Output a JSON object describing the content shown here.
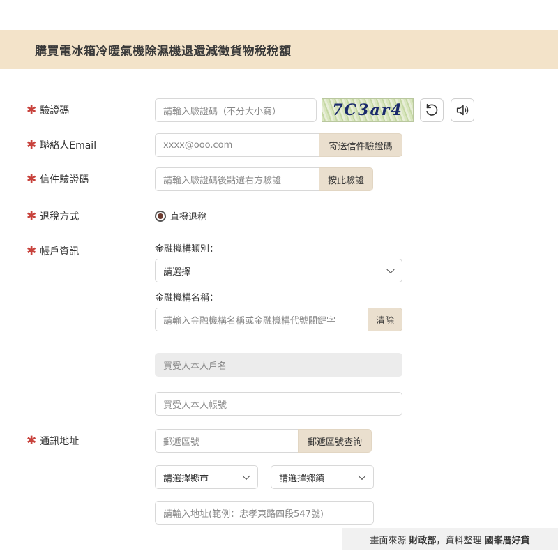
{
  "header": {
    "title": "購買電冰箱冷暖氣機除濕機退還減徵貨物稅稅額"
  },
  "form": {
    "captcha": {
      "label": "驗證碼",
      "placeholder": "請輸入驗證碼（不分大小寫）",
      "image_text": "7C3ar4",
      "refresh_icon": "refresh-icon",
      "audio_icon": "speaker-icon"
    },
    "email": {
      "label": "聯絡人Email",
      "placeholder": "xxxx@ooo.com",
      "button": "寄送信件驗證碼"
    },
    "email_code": {
      "label": "信件驗證碼",
      "placeholder": "請輸入驗證碼後點選右方驗證",
      "button": "按此驗證"
    },
    "refund_method": {
      "label": "退稅方式",
      "option": "直撥退稅"
    },
    "account": {
      "label": "帳戶資訊",
      "bank_type_label": "金融機構類別：",
      "bank_type_value": "請選擇",
      "bank_name_label": "金融機構名稱：",
      "bank_name_placeholder": "請輸入金融機構名稱或金融機構代號關鍵字",
      "clear_button": "清除",
      "holder_name_placeholder": "買受人本人戶名",
      "account_no_placeholder": "買受人本人帳號"
    },
    "address": {
      "label": "通訊地址",
      "zip_placeholder": "郵遞區號",
      "zip_button": "郵遞區號查詢",
      "city_value": "請選擇縣市",
      "township_value": "請選擇鄉鎮",
      "address_placeholder": "請輸入地址(範例：忠孝東路四段547號)"
    }
  },
  "footer": {
    "source_prefix": "畫面來源",
    "source": "財政部",
    "separator": "，",
    "compiled_prefix": "資料整理",
    "compiled_by": "國峯厝好貸"
  },
  "colors": {
    "accent_star": "#c8423c",
    "header_bg": "#f3e3c9",
    "button_bg": "#eadfce"
  }
}
